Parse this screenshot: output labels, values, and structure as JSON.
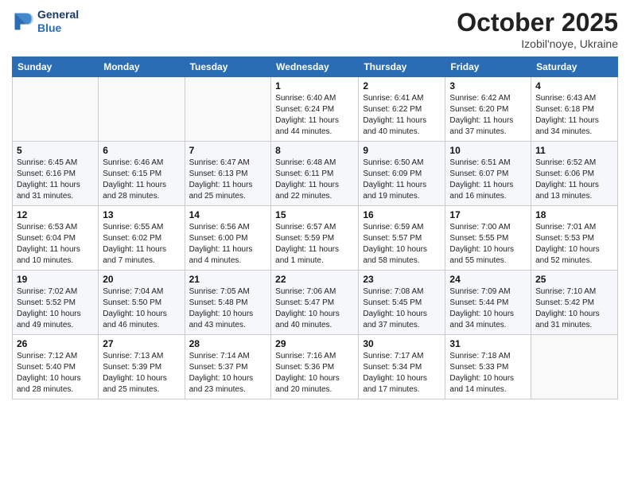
{
  "header": {
    "logo_line1": "General",
    "logo_line2": "Blue",
    "month": "October 2025",
    "location": "Izobil'noye, Ukraine"
  },
  "weekdays": [
    "Sunday",
    "Monday",
    "Tuesday",
    "Wednesday",
    "Thursday",
    "Friday",
    "Saturday"
  ],
  "weeks": [
    [
      {
        "day": "",
        "info": ""
      },
      {
        "day": "",
        "info": ""
      },
      {
        "day": "",
        "info": ""
      },
      {
        "day": "1",
        "info": "Sunrise: 6:40 AM\nSunset: 6:24 PM\nDaylight: 11 hours\nand 44 minutes."
      },
      {
        "day": "2",
        "info": "Sunrise: 6:41 AM\nSunset: 6:22 PM\nDaylight: 11 hours\nand 40 minutes."
      },
      {
        "day": "3",
        "info": "Sunrise: 6:42 AM\nSunset: 6:20 PM\nDaylight: 11 hours\nand 37 minutes."
      },
      {
        "day": "4",
        "info": "Sunrise: 6:43 AM\nSunset: 6:18 PM\nDaylight: 11 hours\nand 34 minutes."
      }
    ],
    [
      {
        "day": "5",
        "info": "Sunrise: 6:45 AM\nSunset: 6:16 PM\nDaylight: 11 hours\nand 31 minutes."
      },
      {
        "day": "6",
        "info": "Sunrise: 6:46 AM\nSunset: 6:15 PM\nDaylight: 11 hours\nand 28 minutes."
      },
      {
        "day": "7",
        "info": "Sunrise: 6:47 AM\nSunset: 6:13 PM\nDaylight: 11 hours\nand 25 minutes."
      },
      {
        "day": "8",
        "info": "Sunrise: 6:48 AM\nSunset: 6:11 PM\nDaylight: 11 hours\nand 22 minutes."
      },
      {
        "day": "9",
        "info": "Sunrise: 6:50 AM\nSunset: 6:09 PM\nDaylight: 11 hours\nand 19 minutes."
      },
      {
        "day": "10",
        "info": "Sunrise: 6:51 AM\nSunset: 6:07 PM\nDaylight: 11 hours\nand 16 minutes."
      },
      {
        "day": "11",
        "info": "Sunrise: 6:52 AM\nSunset: 6:06 PM\nDaylight: 11 hours\nand 13 minutes."
      }
    ],
    [
      {
        "day": "12",
        "info": "Sunrise: 6:53 AM\nSunset: 6:04 PM\nDaylight: 11 hours\nand 10 minutes."
      },
      {
        "day": "13",
        "info": "Sunrise: 6:55 AM\nSunset: 6:02 PM\nDaylight: 11 hours\nand 7 minutes."
      },
      {
        "day": "14",
        "info": "Sunrise: 6:56 AM\nSunset: 6:00 PM\nDaylight: 11 hours\nand 4 minutes."
      },
      {
        "day": "15",
        "info": "Sunrise: 6:57 AM\nSunset: 5:59 PM\nDaylight: 11 hours\nand 1 minute."
      },
      {
        "day": "16",
        "info": "Sunrise: 6:59 AM\nSunset: 5:57 PM\nDaylight: 10 hours\nand 58 minutes."
      },
      {
        "day": "17",
        "info": "Sunrise: 7:00 AM\nSunset: 5:55 PM\nDaylight: 10 hours\nand 55 minutes."
      },
      {
        "day": "18",
        "info": "Sunrise: 7:01 AM\nSunset: 5:53 PM\nDaylight: 10 hours\nand 52 minutes."
      }
    ],
    [
      {
        "day": "19",
        "info": "Sunrise: 7:02 AM\nSunset: 5:52 PM\nDaylight: 10 hours\nand 49 minutes."
      },
      {
        "day": "20",
        "info": "Sunrise: 7:04 AM\nSunset: 5:50 PM\nDaylight: 10 hours\nand 46 minutes."
      },
      {
        "day": "21",
        "info": "Sunrise: 7:05 AM\nSunset: 5:48 PM\nDaylight: 10 hours\nand 43 minutes."
      },
      {
        "day": "22",
        "info": "Sunrise: 7:06 AM\nSunset: 5:47 PM\nDaylight: 10 hours\nand 40 minutes."
      },
      {
        "day": "23",
        "info": "Sunrise: 7:08 AM\nSunset: 5:45 PM\nDaylight: 10 hours\nand 37 minutes."
      },
      {
        "day": "24",
        "info": "Sunrise: 7:09 AM\nSunset: 5:44 PM\nDaylight: 10 hours\nand 34 minutes."
      },
      {
        "day": "25",
        "info": "Sunrise: 7:10 AM\nSunset: 5:42 PM\nDaylight: 10 hours\nand 31 minutes."
      }
    ],
    [
      {
        "day": "26",
        "info": "Sunrise: 7:12 AM\nSunset: 5:40 PM\nDaylight: 10 hours\nand 28 minutes."
      },
      {
        "day": "27",
        "info": "Sunrise: 7:13 AM\nSunset: 5:39 PM\nDaylight: 10 hours\nand 25 minutes."
      },
      {
        "day": "28",
        "info": "Sunrise: 7:14 AM\nSunset: 5:37 PM\nDaylight: 10 hours\nand 23 minutes."
      },
      {
        "day": "29",
        "info": "Sunrise: 7:16 AM\nSunset: 5:36 PM\nDaylight: 10 hours\nand 20 minutes."
      },
      {
        "day": "30",
        "info": "Sunrise: 7:17 AM\nSunset: 5:34 PM\nDaylight: 10 hours\nand 17 minutes."
      },
      {
        "day": "31",
        "info": "Sunrise: 7:18 AM\nSunset: 5:33 PM\nDaylight: 10 hours\nand 14 minutes."
      },
      {
        "day": "",
        "info": ""
      }
    ]
  ]
}
